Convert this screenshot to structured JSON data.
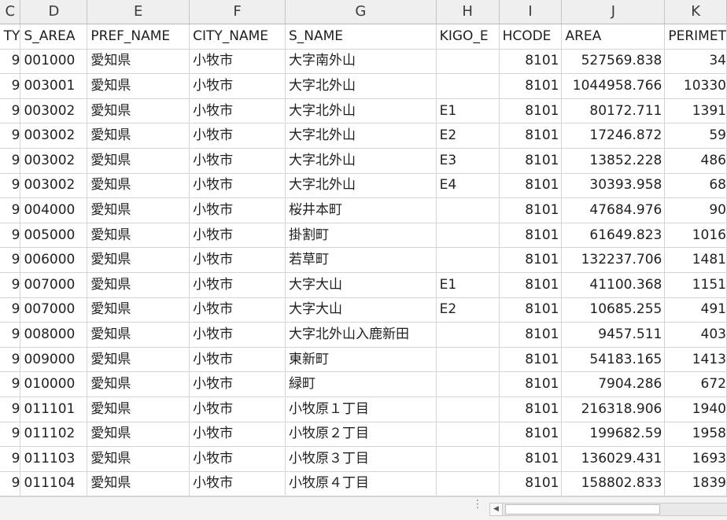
{
  "columns": [
    "C",
    "D",
    "E",
    "F",
    "G",
    "H",
    "I",
    "J",
    "K"
  ],
  "headers": [
    "TY",
    "S_AREA",
    "PREF_NAME",
    "CITY_NAME",
    "S_NAME",
    "KIGO_E",
    "HCODE",
    "AREA",
    "PERIMET"
  ],
  "rows": [
    [
      "9",
      "001000",
      "愛知県",
      "小牧市",
      "大字南外山",
      "",
      "8101",
      "527569.838",
      "34"
    ],
    [
      "9",
      "003001",
      "愛知県",
      "小牧市",
      "大字北外山",
      "",
      "8101",
      "1044958.766",
      "10330"
    ],
    [
      "9",
      "003002",
      "愛知県",
      "小牧市",
      "大字北外山",
      "E1",
      "8101",
      "80172.711",
      "1391"
    ],
    [
      "9",
      "003002",
      "愛知県",
      "小牧市",
      "大字北外山",
      "E2",
      "8101",
      "17246.872",
      "59"
    ],
    [
      "9",
      "003002",
      "愛知県",
      "小牧市",
      "大字北外山",
      "E3",
      "8101",
      "13852.228",
      "486"
    ],
    [
      "9",
      "003002",
      "愛知県",
      "小牧市",
      "大字北外山",
      "E4",
      "8101",
      "30393.958",
      "68"
    ],
    [
      "9",
      "004000",
      "愛知県",
      "小牧市",
      "桜井本町",
      "",
      "8101",
      "47684.976",
      "90"
    ],
    [
      "9",
      "005000",
      "愛知県",
      "小牧市",
      "掛割町",
      "",
      "8101",
      "61649.823",
      "1016"
    ],
    [
      "9",
      "006000",
      "愛知県",
      "小牧市",
      "若草町",
      "",
      "8101",
      "132237.706",
      "1481"
    ],
    [
      "9",
      "007000",
      "愛知県",
      "小牧市",
      "大字大山",
      "E1",
      "8101",
      "41100.368",
      "1151"
    ],
    [
      "9",
      "007000",
      "愛知県",
      "小牧市",
      "大字大山",
      "E2",
      "8101",
      "10685.255",
      "491"
    ],
    [
      "9",
      "008000",
      "愛知県",
      "小牧市",
      "大字北外山入鹿新田",
      "",
      "8101",
      "9457.511",
      "403"
    ],
    [
      "9",
      "009000",
      "愛知県",
      "小牧市",
      "東新町",
      "",
      "8101",
      "54183.165",
      "1413"
    ],
    [
      "9",
      "010000",
      "愛知県",
      "小牧市",
      "緑町",
      "",
      "8101",
      "7904.286",
      "672"
    ],
    [
      "9",
      "011101",
      "愛知県",
      "小牧市",
      "小牧原１丁目",
      "",
      "8101",
      "216318.906",
      "1940"
    ],
    [
      "9",
      "011102",
      "愛知県",
      "小牧市",
      "小牧原２丁目",
      "",
      "8101",
      "199682.59",
      "1958"
    ],
    [
      "9",
      "011103",
      "愛知県",
      "小牧市",
      "小牧原３丁目",
      "",
      "8101",
      "136029.431",
      "1693"
    ],
    [
      "9",
      "011104",
      "愛知県",
      "小牧市",
      "小牧原４丁目",
      "",
      "8101",
      "158802.833",
      "1839"
    ]
  ],
  "statusbar": {
    "split_handle_glyph": "⋮",
    "scroll_left_glyph": "◀",
    "scroll_left_icon": "chevron-left-icon"
  }
}
